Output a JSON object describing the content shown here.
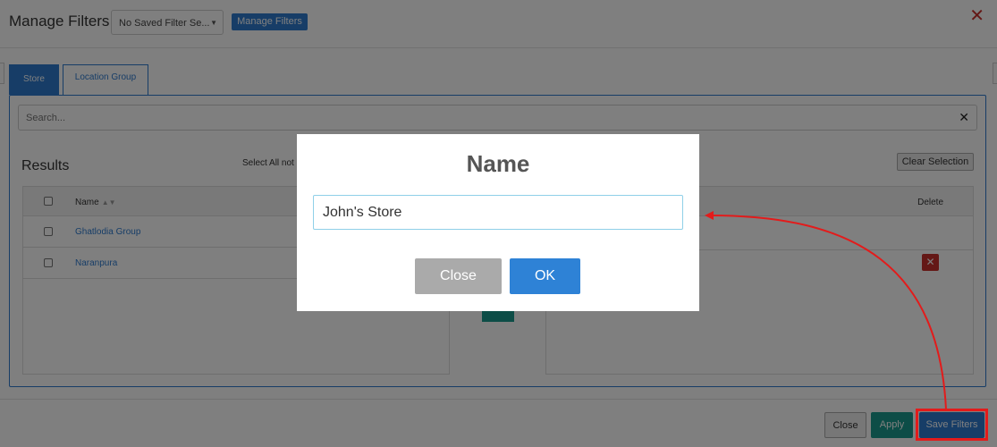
{
  "header": {
    "title": "Manage Filters",
    "saved_filter_value": "No Saved Filter Se...",
    "manage_button": "Manage Filters",
    "close_glyph": "✕"
  },
  "tabs": [
    {
      "label": "Store",
      "active": true
    },
    {
      "label": "Location Group",
      "active": false
    }
  ],
  "search": {
    "placeholder": "Search...",
    "value": "",
    "clear_glyph": "✕"
  },
  "results": {
    "title": "Results",
    "select_all_label": "Select All not",
    "clear_selection_label": "Clear Selection",
    "name_header": "Name",
    "rows": [
      {
        "name": "Ghatlodia Group"
      },
      {
        "name": "Naranpura"
      }
    ],
    "delete_header": "Delete"
  },
  "footer": {
    "close_label": "Close",
    "apply_label": "Apply",
    "save_label": "Save Filters"
  },
  "modal": {
    "title": "Name",
    "input_value": "John's Store",
    "close_label": "Close",
    "ok_label": "OK"
  },
  "colors": {
    "primary": "#2e7bcf",
    "teal": "#1a9b8e",
    "danger": "#c9302c",
    "annotation": "#e31b1b"
  },
  "icons": {
    "close": "close-icon",
    "sort": "sort-icon",
    "caret": "caret-down-icon",
    "delete": "delete-icon",
    "arrow": "annotation-arrow"
  }
}
